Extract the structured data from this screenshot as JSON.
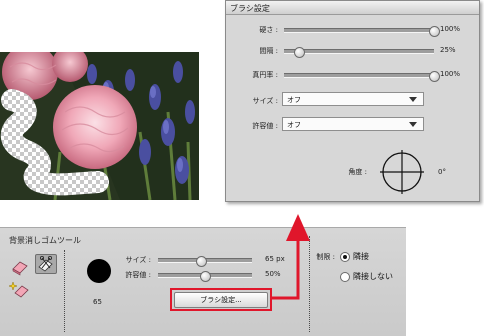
{
  "brush_settings_panel": {
    "title": "ブラシ設定",
    "hardness": {
      "label": "硬さ :",
      "value": 100,
      "display": "100%"
    },
    "spacing": {
      "label": "間隔 :",
      "value": 25,
      "display": "25%"
    },
    "roundness": {
      "label": "真円率 :",
      "value": 100,
      "display": "100%"
    },
    "size_mode": {
      "label": "サイズ :",
      "selected": "オフ"
    },
    "tolerance_mode": {
      "label": "許容値 :",
      "selected": "オフ"
    },
    "angle": {
      "label": "角度 :",
      "value": "0°"
    }
  },
  "tool_options": {
    "tool_name": "背景消しゴムツール",
    "brush_size_number": "65",
    "size": {
      "label": "サイズ :",
      "value": 65,
      "display": "65 px"
    },
    "tolerance": {
      "label": "許容値 :",
      "value": 50,
      "display": "50%"
    },
    "brush_settings_button": "ブラシ設定...",
    "limits": {
      "label": "制限 :",
      "options": [
        "隣接",
        "隣接しない"
      ],
      "selected": "隣接"
    }
  },
  "colors": {
    "callout_red": "#e0162b",
    "panel_bg": "#d7d7d7"
  },
  "icons": [
    "eraser-icon",
    "background-eraser-icon",
    "magic-eraser-icon"
  ]
}
